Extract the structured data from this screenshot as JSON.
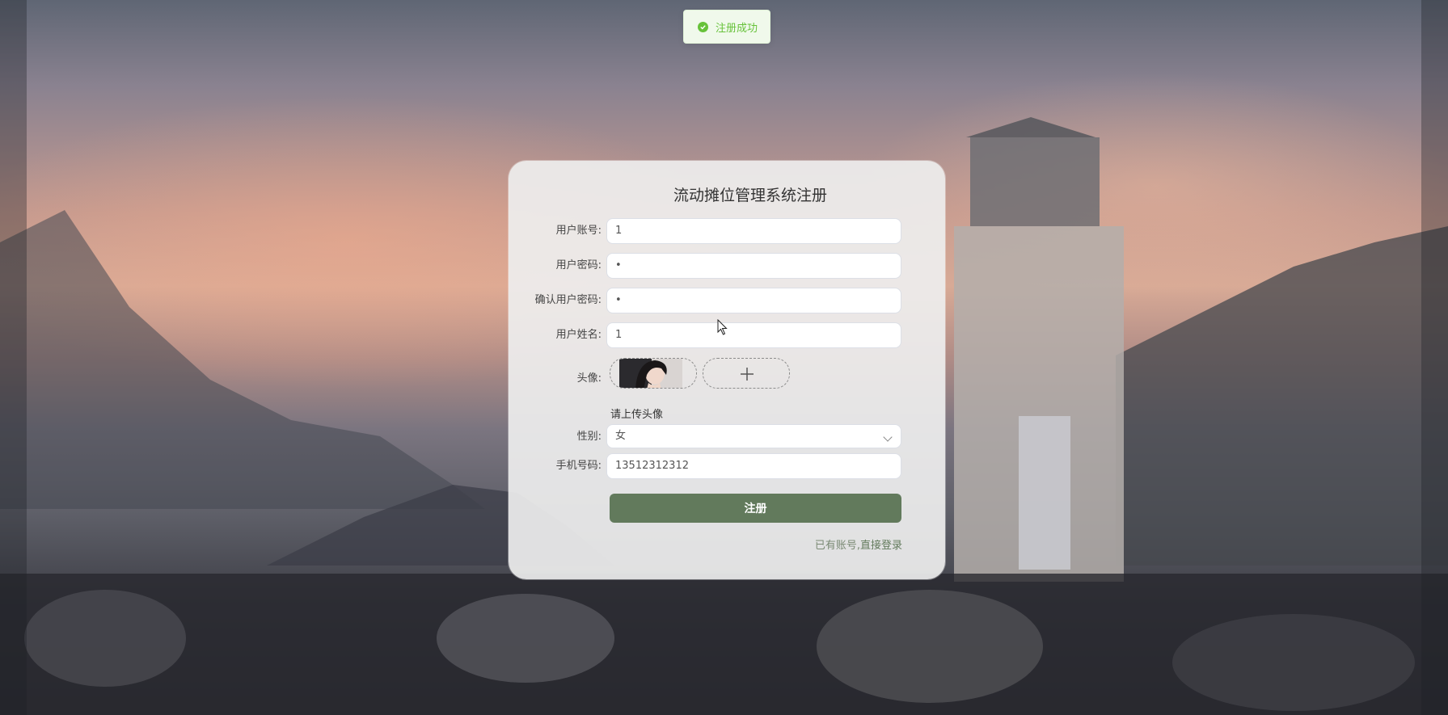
{
  "toast": {
    "icon": "check-circle-icon",
    "text": "注册成功",
    "color": "#67c23a"
  },
  "form": {
    "title": "流动摊位管理系统注册",
    "username": {
      "label": "用户账号:",
      "value": "1"
    },
    "password": {
      "label": "用户密码:",
      "value": "•"
    },
    "confirm_password": {
      "label": "确认用户密码:",
      "value": "•"
    },
    "name": {
      "label": "用户姓名:",
      "value": "1"
    },
    "avatar": {
      "label": "头像:",
      "hint": "请上传头像",
      "add_icon": "plus-icon"
    },
    "gender": {
      "label": "性别:",
      "value": "女",
      "icon": "chevron-down-icon"
    },
    "phone": {
      "label": "手机号码:",
      "value": "13512312312"
    },
    "submit_label": "注册",
    "login_prompt": "已有账号,",
    "login_link": "直接登录"
  },
  "colors": {
    "primary": "#627a5c",
    "success": "#67c23a"
  }
}
